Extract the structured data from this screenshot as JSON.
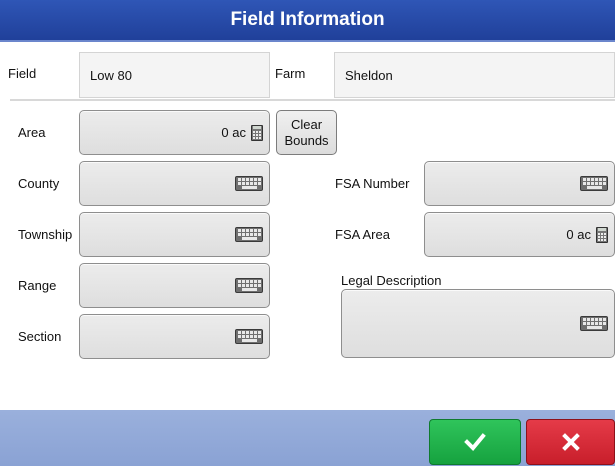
{
  "window": {
    "title": "Field Information"
  },
  "header": {
    "field_label": "Field",
    "field_value": "Low 80",
    "farm_label": "Farm",
    "farm_value": "Sheldon"
  },
  "form": {
    "area_label": "Area",
    "area_value": "0 ac",
    "clear_bounds_line1": "Clear",
    "clear_bounds_line2": "Bounds",
    "county_label": "County",
    "county_value": "",
    "township_label": "Township",
    "township_value": "",
    "range_label": "Range",
    "range_value": "",
    "section_label": "Section",
    "section_value": "",
    "fsa_number_label": "FSA Number",
    "fsa_number_value": "",
    "fsa_area_label": "FSA Area",
    "fsa_area_value": "0 ac",
    "legal_description_label": "Legal Description",
    "legal_description_value": ""
  },
  "icons": {
    "keyboard": "keyboard-icon",
    "calculator": "calculator-icon",
    "ok": "checkmark-icon",
    "cancel": "x-icon"
  },
  "colors": {
    "title_bar": "#2a4fae",
    "footer": "#92a9d8",
    "ok_button": "#22b34c",
    "cancel_button": "#d42a37"
  }
}
